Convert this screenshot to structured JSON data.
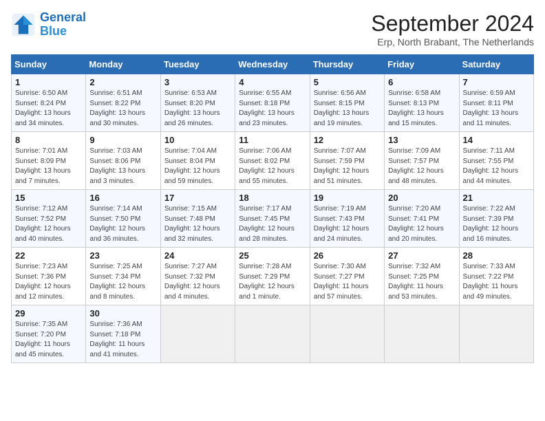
{
  "header": {
    "logo_line1": "General",
    "logo_line2": "Blue",
    "month_title": "September 2024",
    "location": "Erp, North Brabant, The Netherlands"
  },
  "weekdays": [
    "Sunday",
    "Monday",
    "Tuesday",
    "Wednesday",
    "Thursday",
    "Friday",
    "Saturday"
  ],
  "weeks": [
    [
      {
        "day": "1",
        "sunrise": "Sunrise: 6:50 AM",
        "sunset": "Sunset: 8:24 PM",
        "daylight": "Daylight: 13 hours and 34 minutes."
      },
      {
        "day": "2",
        "sunrise": "Sunrise: 6:51 AM",
        "sunset": "Sunset: 8:22 PM",
        "daylight": "Daylight: 13 hours and 30 minutes."
      },
      {
        "day": "3",
        "sunrise": "Sunrise: 6:53 AM",
        "sunset": "Sunset: 8:20 PM",
        "daylight": "Daylight: 13 hours and 26 minutes."
      },
      {
        "day": "4",
        "sunrise": "Sunrise: 6:55 AM",
        "sunset": "Sunset: 8:18 PM",
        "daylight": "Daylight: 13 hours and 23 minutes."
      },
      {
        "day": "5",
        "sunrise": "Sunrise: 6:56 AM",
        "sunset": "Sunset: 8:15 PM",
        "daylight": "Daylight: 13 hours and 19 minutes."
      },
      {
        "day": "6",
        "sunrise": "Sunrise: 6:58 AM",
        "sunset": "Sunset: 8:13 PM",
        "daylight": "Daylight: 13 hours and 15 minutes."
      },
      {
        "day": "7",
        "sunrise": "Sunrise: 6:59 AM",
        "sunset": "Sunset: 8:11 PM",
        "daylight": "Daylight: 13 hours and 11 minutes."
      }
    ],
    [
      {
        "day": "8",
        "sunrise": "Sunrise: 7:01 AM",
        "sunset": "Sunset: 8:09 PM",
        "daylight": "Daylight: 13 hours and 7 minutes."
      },
      {
        "day": "9",
        "sunrise": "Sunrise: 7:03 AM",
        "sunset": "Sunset: 8:06 PM",
        "daylight": "Daylight: 13 hours and 3 minutes."
      },
      {
        "day": "10",
        "sunrise": "Sunrise: 7:04 AM",
        "sunset": "Sunset: 8:04 PM",
        "daylight": "Daylight: 12 hours and 59 minutes."
      },
      {
        "day": "11",
        "sunrise": "Sunrise: 7:06 AM",
        "sunset": "Sunset: 8:02 PM",
        "daylight": "Daylight: 12 hours and 55 minutes."
      },
      {
        "day": "12",
        "sunrise": "Sunrise: 7:07 AM",
        "sunset": "Sunset: 7:59 PM",
        "daylight": "Daylight: 12 hours and 51 minutes."
      },
      {
        "day": "13",
        "sunrise": "Sunrise: 7:09 AM",
        "sunset": "Sunset: 7:57 PM",
        "daylight": "Daylight: 12 hours and 48 minutes."
      },
      {
        "day": "14",
        "sunrise": "Sunrise: 7:11 AM",
        "sunset": "Sunset: 7:55 PM",
        "daylight": "Daylight: 12 hours and 44 minutes."
      }
    ],
    [
      {
        "day": "15",
        "sunrise": "Sunrise: 7:12 AM",
        "sunset": "Sunset: 7:52 PM",
        "daylight": "Daylight: 12 hours and 40 minutes."
      },
      {
        "day": "16",
        "sunrise": "Sunrise: 7:14 AM",
        "sunset": "Sunset: 7:50 PM",
        "daylight": "Daylight: 12 hours and 36 minutes."
      },
      {
        "day": "17",
        "sunrise": "Sunrise: 7:15 AM",
        "sunset": "Sunset: 7:48 PM",
        "daylight": "Daylight: 12 hours and 32 minutes."
      },
      {
        "day": "18",
        "sunrise": "Sunrise: 7:17 AM",
        "sunset": "Sunset: 7:45 PM",
        "daylight": "Daylight: 12 hours and 28 minutes."
      },
      {
        "day": "19",
        "sunrise": "Sunrise: 7:19 AM",
        "sunset": "Sunset: 7:43 PM",
        "daylight": "Daylight: 12 hours and 24 minutes."
      },
      {
        "day": "20",
        "sunrise": "Sunrise: 7:20 AM",
        "sunset": "Sunset: 7:41 PM",
        "daylight": "Daylight: 12 hours and 20 minutes."
      },
      {
        "day": "21",
        "sunrise": "Sunrise: 7:22 AM",
        "sunset": "Sunset: 7:39 PM",
        "daylight": "Daylight: 12 hours and 16 minutes."
      }
    ],
    [
      {
        "day": "22",
        "sunrise": "Sunrise: 7:23 AM",
        "sunset": "Sunset: 7:36 PM",
        "daylight": "Daylight: 12 hours and 12 minutes."
      },
      {
        "day": "23",
        "sunrise": "Sunrise: 7:25 AM",
        "sunset": "Sunset: 7:34 PM",
        "daylight": "Daylight: 12 hours and 8 minutes."
      },
      {
        "day": "24",
        "sunrise": "Sunrise: 7:27 AM",
        "sunset": "Sunset: 7:32 PM",
        "daylight": "Daylight: 12 hours and 4 minutes."
      },
      {
        "day": "25",
        "sunrise": "Sunrise: 7:28 AM",
        "sunset": "Sunset: 7:29 PM",
        "daylight": "Daylight: 12 hours and 1 minute."
      },
      {
        "day": "26",
        "sunrise": "Sunrise: 7:30 AM",
        "sunset": "Sunset: 7:27 PM",
        "daylight": "Daylight: 11 hours and 57 minutes."
      },
      {
        "day": "27",
        "sunrise": "Sunrise: 7:32 AM",
        "sunset": "Sunset: 7:25 PM",
        "daylight": "Daylight: 11 hours and 53 minutes."
      },
      {
        "day": "28",
        "sunrise": "Sunrise: 7:33 AM",
        "sunset": "Sunset: 7:22 PM",
        "daylight": "Daylight: 11 hours and 49 minutes."
      }
    ],
    [
      {
        "day": "29",
        "sunrise": "Sunrise: 7:35 AM",
        "sunset": "Sunset: 7:20 PM",
        "daylight": "Daylight: 11 hours and 45 minutes."
      },
      {
        "day": "30",
        "sunrise": "Sunrise: 7:36 AM",
        "sunset": "Sunset: 7:18 PM",
        "daylight": "Daylight: 11 hours and 41 minutes."
      },
      null,
      null,
      null,
      null,
      null
    ]
  ]
}
